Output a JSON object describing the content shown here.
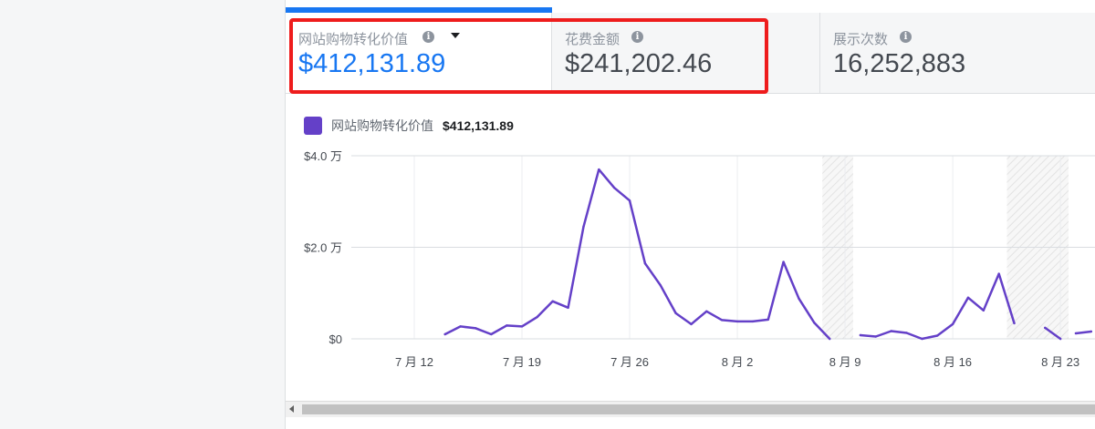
{
  "metrics": [
    {
      "label": "网站购物转化价值",
      "value": "$412,131.89",
      "has_dropdown": true,
      "active": true
    },
    {
      "label": "花费金额",
      "value": "$241,202.46",
      "has_dropdown": false,
      "active": false
    },
    {
      "label": "展示次数",
      "value": "16,252,883",
      "has_dropdown": false,
      "active": false
    }
  ],
  "colors": {
    "accent": "#1877f2",
    "series": "#6440c8",
    "highlight": "#ee1c1c"
  },
  "chart_data": {
    "type": "line",
    "legend": {
      "label": "网站购物转化价值",
      "value": "$412,131.89"
    },
    "ytick_labels": [
      "$0",
      "$2.0 万",
      "$4.0 万"
    ],
    "yticks": [
      0,
      20000,
      40000
    ],
    "ylim": [
      0,
      40000
    ],
    "xtick_labels": [
      "7 月 12",
      "7 月 19",
      "7 月 26",
      "8 月 2",
      "8 月 9",
      "8 月 16",
      "8 月 23"
    ],
    "xticks": [
      "2020-07-12",
      "2020-07-19",
      "2020-07-26",
      "2020-08-02",
      "2020-08-09",
      "2020-08-16",
      "2020-08-23"
    ],
    "grid": true,
    "series": [
      {
        "x": [
          "2020-07-14",
          "2020-07-15",
          "2020-07-16",
          "2020-07-17",
          "2020-07-18",
          "2020-07-19",
          "2020-07-20",
          "2020-07-21",
          "2020-07-22",
          "2020-07-23",
          "2020-07-24",
          "2020-07-25",
          "2020-07-26",
          "2020-07-27",
          "2020-07-28",
          "2020-07-29",
          "2020-07-30",
          "2020-07-31",
          "2020-08-01",
          "2020-08-02",
          "2020-08-03",
          "2020-08-04",
          "2020-08-05",
          "2020-08-06",
          "2020-08-07",
          "2020-08-08",
          "2020-08-10",
          "2020-08-11",
          "2020-08-12",
          "2020-08-13",
          "2020-08-14",
          "2020-08-15",
          "2020-08-16",
          "2020-08-17",
          "2020-08-18",
          "2020-08-19",
          "2020-08-20",
          "2020-08-22",
          "2020-08-23",
          "2020-08-24",
          "2020-08-25"
        ],
        "values": [
          1000,
          2700,
          2300,
          1000,
          2900,
          2700,
          4800,
          8200,
          6800,
          24500,
          37000,
          33000,
          30200,
          16500,
          11700,
          5600,
          3200,
          6000,
          4100,
          3800,
          3800,
          4200,
          16800,
          8800,
          3500,
          0,
          800,
          500,
          1700,
          1300,
          0,
          700,
          3200,
          9000,
          6200,
          14200,
          3400,
          2400,
          0,
          1200,
          1600
        ],
        "segment_breaks_before": [
          "2020-08-10",
          "2020-08-22",
          "2020-08-24"
        ]
      }
    ],
    "shaded_days": [
      "2020-08-08",
      "2020-08-20",
      "2020-08-22"
    ]
  }
}
